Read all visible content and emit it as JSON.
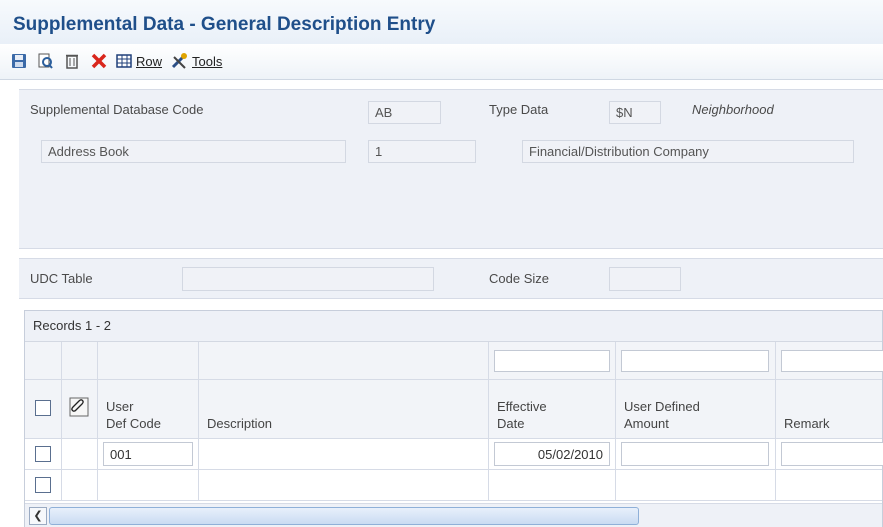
{
  "title": "Supplemental Data - General Description Entry",
  "toolbar": {
    "row_label": "Row",
    "tools_label": "Tools"
  },
  "header": {
    "db_code_label": "Supplemental Database Code",
    "db_code_value": "AB",
    "db_code_desc": "Address Book",
    "seq_value": "1",
    "type_data_label": "Type Data",
    "type_data_value": "$N",
    "type_data_desc": "Neighborhood",
    "company_desc": "Financial/Distribution Company",
    "udc_table_label": "UDC Table",
    "code_size_label": "Code Size"
  },
  "grid": {
    "records_label": "Records 1 - 2",
    "columns": {
      "user_def_code_1": "User",
      "user_def_code_2": "Def Code",
      "description": "Description",
      "effective_date_1": "Effective",
      "effective_date_2": "Date",
      "user_defined_amount_1": "User Defined",
      "user_defined_amount_2": "Amount",
      "remark": "Remark"
    },
    "rows": [
      {
        "user_def_code": "001",
        "description": "",
        "effective_date": "05/02/2010",
        "amount": "",
        "remark": ""
      },
      {
        "user_def_code": "",
        "description": "",
        "effective_date": "",
        "amount": "",
        "remark": ""
      }
    ]
  },
  "colors": {
    "title": "#1f4f8a",
    "panel": "#eef1f7",
    "delete_icon": "#d9261c"
  }
}
